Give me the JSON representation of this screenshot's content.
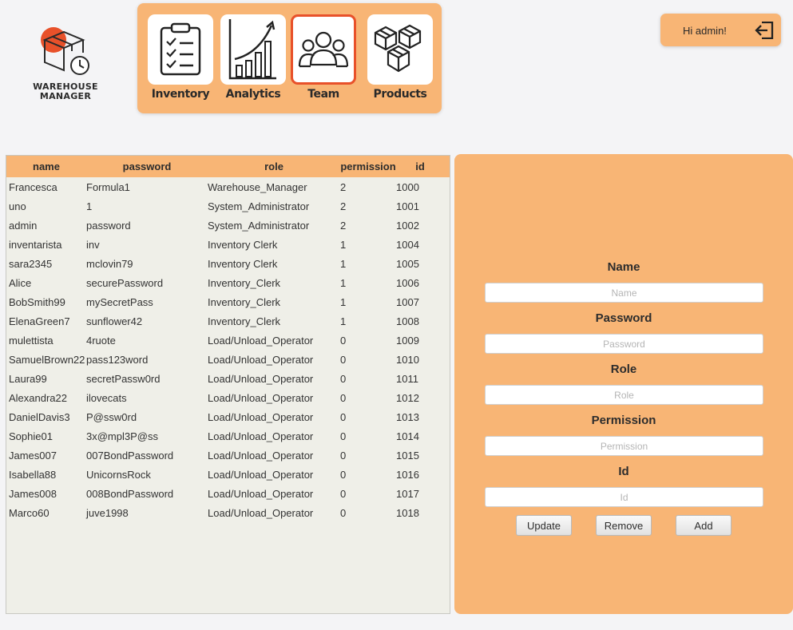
{
  "logo": {
    "line1": "WAREHOUSE",
    "line2": "MANAGER",
    "accent_color": "#e8512a"
  },
  "nav": {
    "items": [
      {
        "label": "Inventory",
        "icon": "clipboard-checklist-icon"
      },
      {
        "label": "Analytics",
        "icon": "bar-chart-growth-icon"
      },
      {
        "label": "Team",
        "icon": "team-users-icon",
        "active": true
      },
      {
        "label": "Products",
        "icon": "boxes-icon"
      }
    ]
  },
  "header": {
    "greeting": "Hi admin!",
    "logout_icon": "logout-icon"
  },
  "table": {
    "columns": [
      "name",
      "password",
      "role",
      "permission",
      "id"
    ],
    "rows": [
      [
        "Francesca",
        "Formula1",
        "Warehouse_Manager",
        "2",
        "1000"
      ],
      [
        "uno",
        "1",
        "System_Administrator",
        "2",
        "1001"
      ],
      [
        "admin",
        "password",
        "System_Administrator",
        "2",
        "1002"
      ],
      [
        "inventarista",
        "inv",
        "Inventory Clerk",
        "1",
        "1004"
      ],
      [
        "sara2345",
        "mclovin79",
        "Inventory Clerk",
        "1",
        "1005"
      ],
      [
        "Alice",
        "securePassword",
        "Inventory_Clerk",
        "1",
        "1006"
      ],
      [
        "BobSmith99",
        "mySecretPass",
        "Inventory_Clerk",
        "1",
        "1007"
      ],
      [
        "ElenaGreen7",
        "sunflower42",
        "Inventory_Clerk",
        "1",
        "1008"
      ],
      [
        "mulettista",
        "4ruote",
        "Load/Unload_Operator",
        "0",
        "1009"
      ],
      [
        "SamuelBrown22",
        "pass123word",
        "Load/Unload_Operator",
        "0",
        "1010"
      ],
      [
        "Laura99",
        "secretPassw0rd",
        "Load/Unload_Operator",
        "0",
        "1011"
      ],
      [
        "Alexandra22",
        "ilovecats",
        "Load/Unload_Operator",
        "0",
        "1012"
      ],
      [
        "DanielDavis3",
        "P@ssw0rd",
        "Load/Unload_Operator",
        "0",
        "1013"
      ],
      [
        "Sophie01",
        "3x@mpl3P@ss",
        "Load/Unload_Operator",
        "0",
        "1014"
      ],
      [
        "James007",
        "007BondPassword",
        "Load/Unload_Operator",
        "0",
        "1015"
      ],
      [
        "Isabella88",
        "UnicornsRock",
        "Load/Unload_Operator",
        "0",
        "1016"
      ],
      [
        "James008",
        "008BondPassword",
        "Load/Unload_Operator",
        "0",
        "1017"
      ],
      [
        "Marco60",
        "juve1998",
        "Load/Unload_Operator",
        "0",
        "1018"
      ]
    ]
  },
  "form": {
    "name": {
      "label": "Name",
      "placeholder": "Name",
      "value": ""
    },
    "password": {
      "label": "Password",
      "placeholder": "Password",
      "value": ""
    },
    "role": {
      "label": "Role",
      "placeholder": "Role",
      "value": ""
    },
    "permission": {
      "label": "Permission",
      "placeholder": "Permission",
      "value": ""
    },
    "id": {
      "label": "Id",
      "placeholder": "Id",
      "value": ""
    },
    "buttons": {
      "update": "Update",
      "remove": "Remove",
      "add": "Add"
    }
  },
  "colors": {
    "panel": "#f8b575",
    "active_border": "#e8512a",
    "page_bg": "#f4f4f6",
    "table_bg": "#efefe8"
  }
}
